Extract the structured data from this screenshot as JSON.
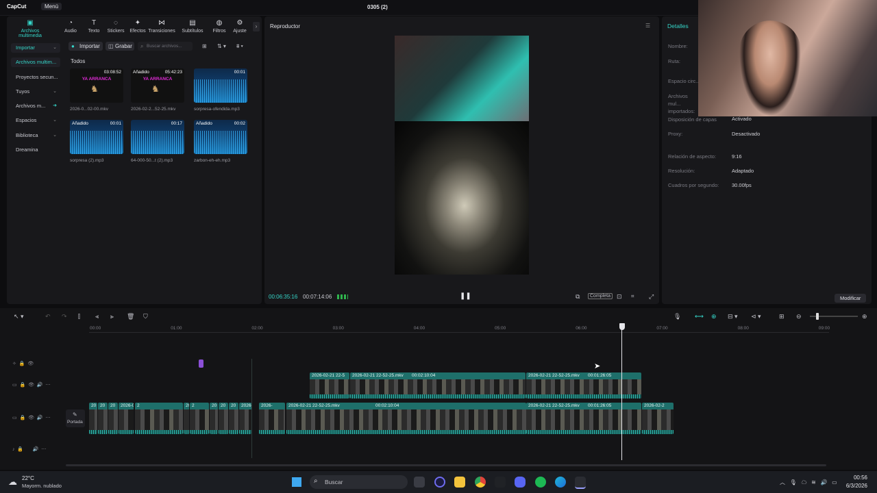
{
  "app": {
    "name": "CapCut",
    "menu": "Menú",
    "window_title": "0305 (2)"
  },
  "toolbar": [
    {
      "label": "Archivos multimedia",
      "icon": "media-icon"
    },
    {
      "label": "Audio",
      "icon": "audio-icon"
    },
    {
      "label": "Texto",
      "icon": "text-icon"
    },
    {
      "label": "Stickers",
      "icon": "sticker-icon"
    },
    {
      "label": "Efectos",
      "icon": "effects-icon"
    },
    {
      "label": "Transiciones",
      "icon": "transition-icon"
    },
    {
      "label": "Subtítulos",
      "icon": "subtitle-icon"
    },
    {
      "label": "Filtros",
      "icon": "filter-icon"
    },
    {
      "label": "Ajuste",
      "icon": "adjust-icon"
    }
  ],
  "sidebar": [
    {
      "label": "Importar"
    },
    {
      "label": "Archivos multim..."
    },
    {
      "label": "Proyectos secun..."
    },
    {
      "label": "Tuyos"
    },
    {
      "label": "Archivos m..."
    },
    {
      "label": "Espacios"
    },
    {
      "label": "Biblioteca"
    },
    {
      "label": "Dreamina"
    }
  ],
  "media": {
    "import_label": "Importar",
    "record_label": "Grabar",
    "search_placeholder": "Buscar archivos...",
    "filter_all": "Todos",
    "items": [
      {
        "name": "2026-0...02-00.mkv",
        "duration": "03:08:52",
        "added": ""
      },
      {
        "name": "2026-02-2...52-25.mkv",
        "duration": "05:42:23",
        "added": "Añadido"
      },
      {
        "name": "sorpresa-ofendida.mp3",
        "duration": "00:01",
        "added": ""
      },
      {
        "name": "sorpresa (2).mp3",
        "duration": "00:01",
        "added": "Añadido"
      },
      {
        "name": "64-000-50...t (2).mp3",
        "duration": "00:17",
        "added": ""
      },
      {
        "name": "zarbon-eh-eh.mp3",
        "duration": "00:02",
        "added": "Añadido"
      }
    ],
    "thumb_text": "YA ARRANCA"
  },
  "player": {
    "title": "Reproductor",
    "current_time": "00:06:35:16",
    "total_time": "00:07:14:06",
    "ratio_label": "Completa"
  },
  "details": {
    "title": "Detalles",
    "fields": [
      {
        "label": "Nombre:",
        "value": ""
      },
      {
        "label": "Ruta:",
        "value": ""
      },
      {
        "label": "Espacio circ...",
        "value": ""
      },
      {
        "label": "Archivos mul... importados:",
        "value": ""
      },
      {
        "label": "Disposición de capas",
        "value": "Activado"
      },
      {
        "label": "Proxy:",
        "value": "Desactivado"
      },
      {
        "label": "Relación de aspecto:",
        "value": "9:16"
      },
      {
        "label": "Resolución:",
        "value": "Adaptado"
      },
      {
        "label": "Cuadros por segundo:",
        "value": "30.00fps"
      }
    ],
    "modify_label": "Modificar"
  },
  "timeline": {
    "ruler": [
      "00:00",
      "01:00",
      "02:00",
      "03:00",
      "04:00",
      "05:00",
      "06:00",
      "07:00",
      "08:00",
      "09:00"
    ],
    "cover_label": "Portada",
    "clips_upper": [
      {
        "title": "2026-02-21 22-5",
        "duration": ""
      },
      {
        "title": "2026-02-21 22-52-25.mkv",
        "duration": "00:02:10:04"
      },
      {
        "title": "2026-02-21 22-52-25.mkv",
        "duration": "00:01:26:05"
      }
    ],
    "clips_main": [
      {
        "title": "20",
        "duration": ""
      },
      {
        "title": "20",
        "duration": ""
      },
      {
        "title": "20",
        "duration": ""
      },
      {
        "title": "2026-02-21 22-5",
        "duration": ""
      },
      {
        "title": "2",
        "duration": ""
      },
      {
        "title": "2026-",
        "duration": ""
      },
      {
        "title": "2",
        "duration": ""
      },
      {
        "title": "20",
        "duration": ""
      },
      {
        "title": "20",
        "duration": ""
      },
      {
        "title": "20",
        "duration": ""
      },
      {
        "title": "2026-",
        "duration": ""
      },
      {
        "title": "2026-",
        "duration": ""
      },
      {
        "title": "2026-02-21 22-52-25.mkv",
        "duration": "00:02:10:04"
      },
      {
        "title": "2026-02-21 22-52-25.mkv",
        "duration": "00:01:26:05"
      },
      {
        "title": "2026-02-2",
        "duration": ""
      }
    ]
  },
  "taskbar": {
    "weather_temp": "22°C",
    "weather_desc": "Mayorm. nublado",
    "search_placeholder": "Buscar",
    "time": "00:56",
    "date": "6/3/2026"
  },
  "colors": {
    "accent": "#35d6c9",
    "clip": "#1e6f6a",
    "panel": "#18181b"
  }
}
